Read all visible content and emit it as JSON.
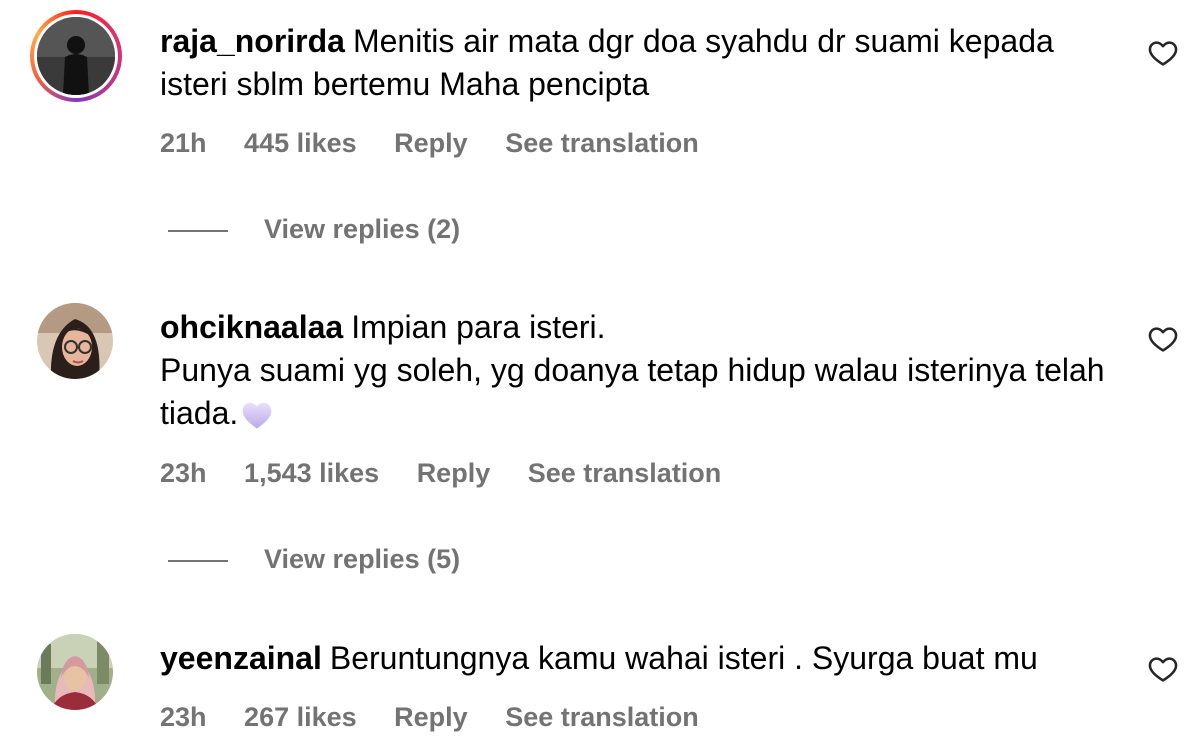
{
  "comments": [
    {
      "username": "raja_norirda",
      "text": "Menitis air mata dgr doa syahdu dr suami kepada isteri sblm bertemu Maha pencipta",
      "time": "21h",
      "likes": "445 likes",
      "reply": "Reply",
      "translate": "See translation",
      "view_replies": "View replies (2)",
      "avatar_icon": "profile-photo-dark-figure",
      "has_story_ring": true
    },
    {
      "username": "ohciknaalaa",
      "text_line1": "Impian para isteri.",
      "text_line2": "Punya suami yg soleh, yg doanya tetap hidup walau isterinya telah tiada.",
      "emoji": "purple-heart",
      "time": "23h",
      "likes": "1,543 likes",
      "reply": "Reply",
      "translate": "See translation",
      "view_replies": "View replies (5)",
      "avatar_icon": "profile-photo-woman-glasses"
    },
    {
      "username": "yeenzainal",
      "text": "Beruntungnya kamu wahai isteri . Syurga buat mu",
      "time": "23h",
      "likes": "267 likes",
      "reply": "Reply",
      "translate": "See translation",
      "avatar_icon": "profile-photo-woman-hijab"
    }
  ],
  "colors": {
    "primary_text": "#000000",
    "secondary_text": "#737373",
    "story_ring": "#e1306c",
    "heart_emoji": "#c9b8f0"
  },
  "icons": {
    "like": "heart-outline-icon"
  }
}
